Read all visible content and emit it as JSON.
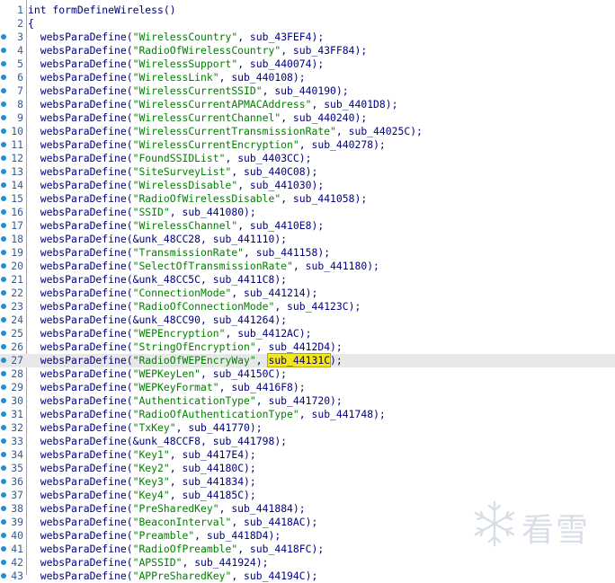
{
  "editor": {
    "highlight_line": 27,
    "lines": [
      {
        "num": "1",
        "dot": false,
        "prefix": "int formDefineWireless()",
        "str": "",
        "mid": "",
        "sub": "",
        "suffix": ""
      },
      {
        "num": "2",
        "dot": false,
        "prefix": "{",
        "str": "",
        "mid": "",
        "sub": "",
        "suffix": ""
      },
      {
        "num": "3",
        "dot": true,
        "prefix": "  websParaDefine(",
        "str": "\"WirelessCountry\"",
        "mid": ", ",
        "sub": "sub_43FEF4",
        "suffix": ");"
      },
      {
        "num": "4",
        "dot": true,
        "prefix": "  websParaDefine(",
        "str": "\"RadioOfWirelessCountry\"",
        "mid": ", ",
        "sub": "sub_43FF84",
        "suffix": ");"
      },
      {
        "num": "5",
        "dot": true,
        "prefix": "  websParaDefine(",
        "str": "\"WirelessSupport\"",
        "mid": ", ",
        "sub": "sub_440074",
        "suffix": ");"
      },
      {
        "num": "6",
        "dot": true,
        "prefix": "  websParaDefine(",
        "str": "\"WirelessLink\"",
        "mid": ", ",
        "sub": "sub_440108",
        "suffix": ");"
      },
      {
        "num": "7",
        "dot": true,
        "prefix": "  websParaDefine(",
        "str": "\"WirelessCurrentSSID\"",
        "mid": ", ",
        "sub": "sub_440190",
        "suffix": ");"
      },
      {
        "num": "8",
        "dot": true,
        "prefix": "  websParaDefine(",
        "str": "\"WirelessCurrentAPMACAddress\"",
        "mid": ", ",
        "sub": "sub_4401D8",
        "suffix": ");"
      },
      {
        "num": "9",
        "dot": true,
        "prefix": "  websParaDefine(",
        "str": "\"WirelessCurrentChannel\"",
        "mid": ", ",
        "sub": "sub_440240",
        "suffix": ");"
      },
      {
        "num": "10",
        "dot": true,
        "prefix": "  websParaDefine(",
        "str": "\"WirelessCurrentTransmissionRate\"",
        "mid": ", ",
        "sub": "sub_44025C",
        "suffix": ");"
      },
      {
        "num": "11",
        "dot": true,
        "prefix": "  websParaDefine(",
        "str": "\"WirelessCurrentEncryption\"",
        "mid": ", ",
        "sub": "sub_440278",
        "suffix": ");"
      },
      {
        "num": "12",
        "dot": true,
        "prefix": "  websParaDefine(",
        "str": "\"FoundSSIDList\"",
        "mid": ", ",
        "sub": "sub_4403CC",
        "suffix": ");"
      },
      {
        "num": "13",
        "dot": true,
        "prefix": "  websParaDefine(",
        "str": "\"SiteSurveyList\"",
        "mid": ", ",
        "sub": "sub_440C08",
        "suffix": ");"
      },
      {
        "num": "14",
        "dot": true,
        "prefix": "  websParaDefine(",
        "str": "\"WirelessDisable\"",
        "mid": ", ",
        "sub": "sub_441030",
        "suffix": ");"
      },
      {
        "num": "15",
        "dot": true,
        "prefix": "  websParaDefine(",
        "str": "\"RadioOfWirelessDisable\"",
        "mid": ", ",
        "sub": "sub_441058",
        "suffix": ");"
      },
      {
        "num": "16",
        "dot": true,
        "prefix": "  websParaDefine(",
        "str": "\"SSID\"",
        "mid": ", ",
        "sub": "sub_441080",
        "suffix": ");"
      },
      {
        "num": "17",
        "dot": true,
        "prefix": "  websParaDefine(",
        "str": "\"WirelessChannel\"",
        "mid": ", ",
        "sub": "sub_4410E8",
        "suffix": ");"
      },
      {
        "num": "18",
        "dot": true,
        "prefix": "  websParaDefine(&unk_48CC28",
        "str": "",
        "mid": ", ",
        "sub": "sub_441110",
        "suffix": ");"
      },
      {
        "num": "19",
        "dot": true,
        "prefix": "  websParaDefine(",
        "str": "\"TransmissionRate\"",
        "mid": ", ",
        "sub": "sub_441158",
        "suffix": ");"
      },
      {
        "num": "20",
        "dot": true,
        "prefix": "  websParaDefine(",
        "str": "\"SelectOfTransmissionRate\"",
        "mid": ", ",
        "sub": "sub_441180",
        "suffix": ");"
      },
      {
        "num": "21",
        "dot": true,
        "prefix": "  websParaDefine(&unk_48CC5C",
        "str": "",
        "mid": ", ",
        "sub": "sub_4411C8",
        "suffix": ");"
      },
      {
        "num": "22",
        "dot": true,
        "prefix": "  websParaDefine(",
        "str": "\"ConnectionMode\"",
        "mid": ", ",
        "sub": "sub_441214",
        "suffix": ");"
      },
      {
        "num": "23",
        "dot": true,
        "prefix": "  websParaDefine(",
        "str": "\"RadioOfConnectionMode\"",
        "mid": ", ",
        "sub": "sub_44123C",
        "suffix": ");"
      },
      {
        "num": "24",
        "dot": true,
        "prefix": "  websParaDefine(&unk_48CC90",
        "str": "",
        "mid": ", ",
        "sub": "sub_441264",
        "suffix": ");"
      },
      {
        "num": "25",
        "dot": true,
        "prefix": "  websParaDefine(",
        "str": "\"WEPEncryption\"",
        "mid": ", ",
        "sub": "sub_4412AC",
        "suffix": ");"
      },
      {
        "num": "26",
        "dot": true,
        "prefix": "  websParaDefine(",
        "str": "\"StringOfEncryption\"",
        "mid": ", ",
        "sub": "sub_4412D4",
        "suffix": ");"
      },
      {
        "num": "27",
        "dot": true,
        "prefix": "  websParaDefine(",
        "str": "\"RadioOfWEPEncryWay\"",
        "mid": ", ",
        "sub": "sub_44131C",
        "suffix": ");"
      },
      {
        "num": "28",
        "dot": true,
        "prefix": "  websParaDefine(",
        "str": "\"WEPKeyLen\"",
        "mid": ", ",
        "sub": "sub_44150C",
        "suffix": ");"
      },
      {
        "num": "29",
        "dot": true,
        "prefix": "  websParaDefine(",
        "str": "\"WEPKeyFormat\"",
        "mid": ", ",
        "sub": "sub_4416F8",
        "suffix": ");"
      },
      {
        "num": "30",
        "dot": true,
        "prefix": "  websParaDefine(",
        "str": "\"AuthenticationType\"",
        "mid": ", ",
        "sub": "sub_441720",
        "suffix": ");"
      },
      {
        "num": "31",
        "dot": true,
        "prefix": "  websParaDefine(",
        "str": "\"RadioOfAuthenticationType\"",
        "mid": ", ",
        "sub": "sub_441748",
        "suffix": ");"
      },
      {
        "num": "32",
        "dot": true,
        "prefix": "  websParaDefine(",
        "str": "\"TxKey\"",
        "mid": ", ",
        "sub": "sub_441770",
        "suffix": ");"
      },
      {
        "num": "33",
        "dot": true,
        "prefix": "  websParaDefine(&unk_48CCF8",
        "str": "",
        "mid": ", ",
        "sub": "sub_441798",
        "suffix": ");"
      },
      {
        "num": "34",
        "dot": true,
        "prefix": "  websParaDefine(",
        "str": "\"Key1\"",
        "mid": ", ",
        "sub": "sub_4417E4",
        "suffix": ");"
      },
      {
        "num": "35",
        "dot": true,
        "prefix": "  websParaDefine(",
        "str": "\"Key2\"",
        "mid": ", ",
        "sub": "sub_44180C",
        "suffix": ");"
      },
      {
        "num": "36",
        "dot": true,
        "prefix": "  websParaDefine(",
        "str": "\"Key3\"",
        "mid": ", ",
        "sub": "sub_441834",
        "suffix": ");"
      },
      {
        "num": "37",
        "dot": true,
        "prefix": "  websParaDefine(",
        "str": "\"Key4\"",
        "mid": ", ",
        "sub": "sub_44185C",
        "suffix": ");"
      },
      {
        "num": "38",
        "dot": true,
        "prefix": "  websParaDefine(",
        "str": "\"PreSharedKey\"",
        "mid": ", ",
        "sub": "sub_441884",
        "suffix": ");"
      },
      {
        "num": "39",
        "dot": true,
        "prefix": "  websParaDefine(",
        "str": "\"BeaconInterval\"",
        "mid": ", ",
        "sub": "sub_4418AC",
        "suffix": ");"
      },
      {
        "num": "40",
        "dot": true,
        "prefix": "  websParaDefine(",
        "str": "\"Preamble\"",
        "mid": ", ",
        "sub": "sub_4418D4",
        "suffix": ");"
      },
      {
        "num": "41",
        "dot": true,
        "prefix": "  websParaDefine(",
        "str": "\"RadioOfPreamble\"",
        "mid": ", ",
        "sub": "sub_4418FC",
        "suffix": ");"
      },
      {
        "num": "42",
        "dot": true,
        "prefix": "  websParaDefine(",
        "str": "\"APSSID\"",
        "mid": ", ",
        "sub": "sub_441924",
        "suffix": ");"
      },
      {
        "num": "43",
        "dot": true,
        "prefix": "  websParaDefine(",
        "str": "\"APPreSharedKey\"",
        "mid": ", ",
        "sub": "sub_44194C",
        "suffix": ");"
      }
    ]
  },
  "watermark": {
    "text": "看雪",
    "icon": "snowflake-icon"
  },
  "colors": {
    "keyword": "#000080",
    "string": "#008000",
    "highlight": "#f2e61a",
    "line_highlight": "#e8e8e8",
    "dot": "#1e90d8"
  }
}
